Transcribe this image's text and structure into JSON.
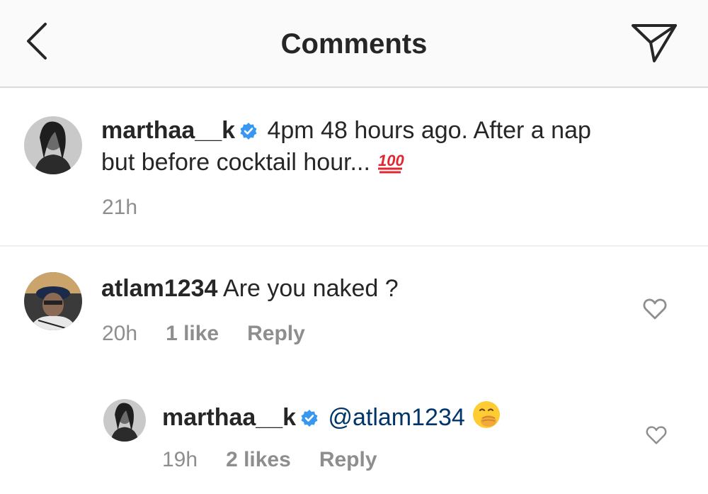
{
  "header": {
    "title": "Comments",
    "back_icon": "chevron-left-icon",
    "share_icon": "paper-plane-icon"
  },
  "caption": {
    "username": "marthaa__k",
    "verified": true,
    "text_line1": "4pm 48 hours ago. After a nap",
    "text_line2": "but before cocktail hour...",
    "emoji": "hundred-points-icon",
    "time": "21h"
  },
  "comments": [
    {
      "username": "atlam1234",
      "text": "Are you naked ?",
      "time": "20h",
      "likes": "1 like",
      "reply": "Reply"
    },
    {
      "username": "marthaa__k",
      "verified": true,
      "mention": "@atlam1234",
      "emoji": "face-with-hand-over-mouth-icon",
      "time": "19h",
      "likes": "2 likes",
      "reply": "Reply"
    }
  ],
  "colors": {
    "text": "#262626",
    "meta": "#8e8e8e",
    "verified": "#3897f0",
    "mention": "#003569",
    "header_bg": "#fafafa"
  }
}
